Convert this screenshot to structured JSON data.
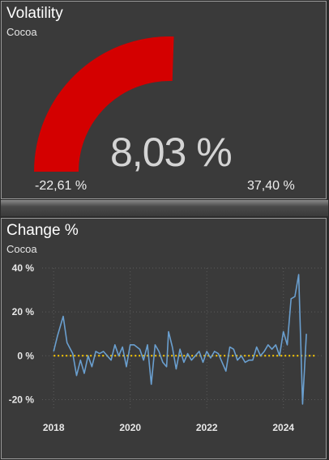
{
  "volatility": {
    "title": "Volatility",
    "subtitle": "Cocoa",
    "value_label": "8,03 %",
    "min_label": "-22,61 %",
    "max_label": "37,40 %",
    "value": 8.03,
    "min": -22.61,
    "max": 37.4,
    "gauge_color": "#d40000"
  },
  "change": {
    "title": "Change %",
    "subtitle": "Cocoa"
  },
  "chart_data": {
    "type": "line",
    "series": [
      {
        "values": [
          [
            2018.0,
            2
          ],
          [
            2018.1,
            9
          ],
          [
            2018.25,
            18
          ],
          [
            2018.35,
            6
          ],
          [
            2018.5,
            1
          ],
          [
            2018.6,
            -9
          ],
          [
            2018.7,
            -2
          ],
          [
            2018.8,
            -8
          ],
          [
            2018.9,
            0
          ],
          [
            2019.0,
            -5
          ],
          [
            2019.1,
            2
          ],
          [
            2019.2,
            1
          ],
          [
            2019.3,
            2
          ],
          [
            2019.4,
            0
          ],
          [
            2019.5,
            -2
          ],
          [
            2019.6,
            5
          ],
          [
            2019.7,
            0
          ],
          [
            2019.8,
            4
          ],
          [
            2019.9,
            -5
          ],
          [
            2020.0,
            5
          ],
          [
            2020.1,
            5
          ],
          [
            2020.25,
            3
          ],
          [
            2020.35,
            -2
          ],
          [
            2020.45,
            5
          ],
          [
            2020.55,
            -13
          ],
          [
            2020.65,
            5
          ],
          [
            2020.75,
            2
          ],
          [
            2020.85,
            -3
          ],
          [
            2020.95,
            -5
          ],
          [
            2021.0,
            11
          ],
          [
            2021.1,
            4
          ],
          [
            2021.2,
            -6
          ],
          [
            2021.3,
            3
          ],
          [
            2021.4,
            -3
          ],
          [
            2021.5,
            1
          ],
          [
            2021.6,
            -2
          ],
          [
            2021.7,
            0
          ],
          [
            2021.8,
            2
          ],
          [
            2021.9,
            -3
          ],
          [
            2022.0,
            2
          ],
          [
            2022.1,
            -1
          ],
          [
            2022.2,
            2
          ],
          [
            2022.3,
            1
          ],
          [
            2022.4,
            -3
          ],
          [
            2022.5,
            -7
          ],
          [
            2022.6,
            4
          ],
          [
            2022.7,
            3
          ],
          [
            2022.8,
            -2
          ],
          [
            2022.9,
            0
          ],
          [
            2023.0,
            -3
          ],
          [
            2023.1,
            -2
          ],
          [
            2023.2,
            -2
          ],
          [
            2023.3,
            4
          ],
          [
            2023.4,
            0
          ],
          [
            2023.5,
            2
          ],
          [
            2023.6,
            5
          ],
          [
            2023.7,
            3
          ],
          [
            2023.8,
            5
          ],
          [
            2023.9,
            0
          ],
          [
            2024.0,
            11
          ],
          [
            2024.1,
            5
          ],
          [
            2024.2,
            26
          ],
          [
            2024.3,
            27
          ],
          [
            2024.4,
            37
          ],
          [
            2024.5,
            -22
          ],
          [
            2024.6,
            10
          ]
        ],
        "color": "#6a9fcf"
      }
    ],
    "xticks": [
      "2018",
      "2020",
      "2022",
      "2024"
    ],
    "xtick_values": [
      2018,
      2020,
      2022,
      2024
    ],
    "yticks": [
      "40 %",
      "20 %",
      "0 %",
      "-20 %"
    ],
    "ytick_values": [
      40,
      20,
      0,
      -20
    ],
    "xlim": [
      2017.7,
      2025.0
    ],
    "ylim": [
      -25,
      40
    ],
    "reference_line": {
      "value": 0,
      "color": "#ffcc00",
      "style": "dotted"
    },
    "grid": true
  }
}
